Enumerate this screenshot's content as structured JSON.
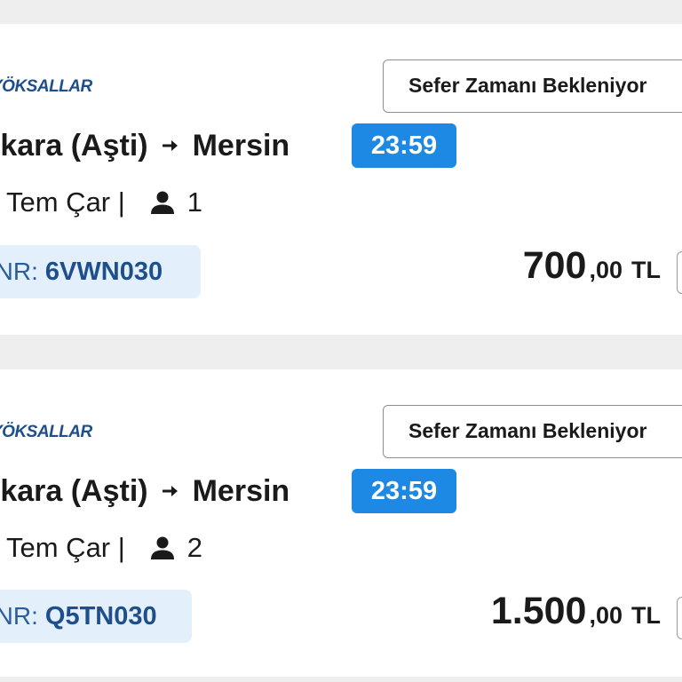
{
  "tickets": [
    {
      "brand": "YÖKSALLAR",
      "status_button": "Sefer Zamanı Bekleniyor",
      "origin": "Ankara (Aşti)",
      "destination": "Mersin",
      "time": "23:59",
      "company": "Tem Çar |",
      "passenger_count": "1",
      "pnr_label": "PNR:",
      "pnr_code": "6VWN030",
      "price_main": "700",
      "price_decimal": ",00",
      "currency": "TL"
    },
    {
      "brand": "YÖKSALLAR",
      "status_button": "Sefer Zamanı Bekleniyor",
      "origin": "Ankara (Aşti)",
      "destination": "Mersin",
      "time": "23:59",
      "company": "Tem Çar |",
      "passenger_count": "2",
      "pnr_label": "PNR:",
      "pnr_code": "Q5TN030",
      "price_main": "1.500",
      "price_decimal": ",00",
      "currency": "TL"
    }
  ],
  "colors": {
    "accent_blue": "#1e88e5",
    "brand_blue": "#1d4f8c",
    "pnr_bg": "#e3f0fc",
    "page_bg": "#eeeeee"
  },
  "icons": {
    "arrow": "arrow-right-icon",
    "person": "person-icon"
  }
}
